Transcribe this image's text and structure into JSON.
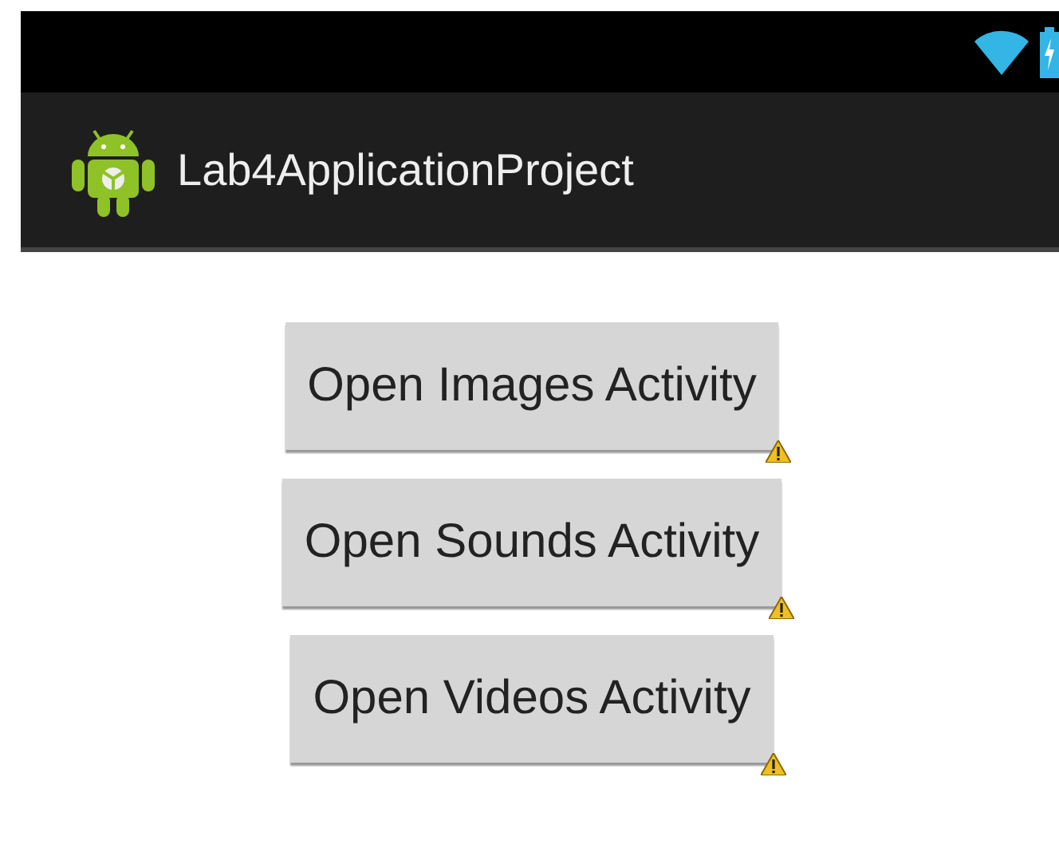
{
  "action_bar": {
    "title": "Lab4ApplicationProject"
  },
  "buttons": [
    {
      "label": "Open Images Activity",
      "warning": true
    },
    {
      "label": "Open Sounds Activity",
      "warning": true
    },
    {
      "label": "Open Videos Activity",
      "warning": true
    }
  ]
}
